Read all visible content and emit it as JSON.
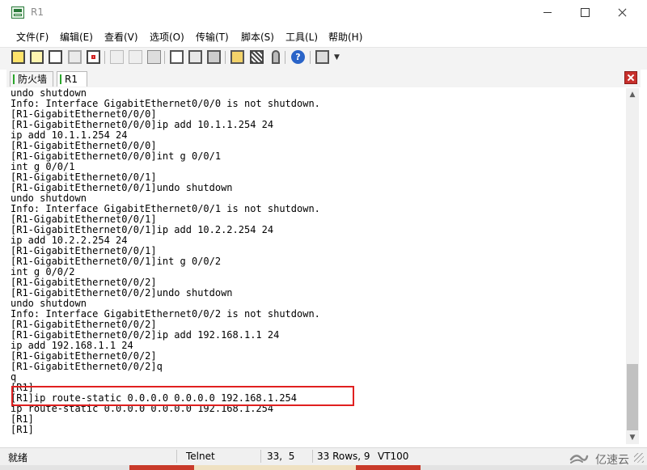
{
  "window": {
    "title": "R1"
  },
  "menu": [
    "文件(F)",
    "编辑(E)",
    "查看(V)",
    "选项(O)",
    "传输(T)",
    "脚本(S)",
    "工具(L)",
    "帮助(H)"
  ],
  "tabs": [
    {
      "label": "防火墙",
      "status_color": "#2aa52a"
    },
    {
      "label": "R1",
      "status_color": "#2aa52a"
    }
  ],
  "terminal": {
    "lines": [
      "undo shutdown",
      "Info: Interface GigabitEthernet0/0/0 is not shutdown.",
      "[R1-GigabitEthernet0/0/0]",
      "[R1-GigabitEthernet0/0/0]ip add 10.1.1.254 24",
      "ip add 10.1.1.254 24",
      "[R1-GigabitEthernet0/0/0]",
      "[R1-GigabitEthernet0/0/0]int g 0/0/1",
      "int g 0/0/1",
      "[R1-GigabitEthernet0/0/1]",
      "[R1-GigabitEthernet0/0/1]undo shutdown",
      "undo shutdown",
      "Info: Interface GigabitEthernet0/0/1 is not shutdown.",
      "[R1-GigabitEthernet0/0/1]",
      "[R1-GigabitEthernet0/0/1]ip add 10.2.2.254 24",
      "ip add 10.2.2.254 24",
      "[R1-GigabitEthernet0/0/1]",
      "[R1-GigabitEthernet0/0/1]int g 0/0/2",
      "int g 0/0/2",
      "[R1-GigabitEthernet0/0/2]",
      "[R1-GigabitEthernet0/0/2]undo shutdown",
      "undo shutdown",
      "Info: Interface GigabitEthernet0/0/2 is not shutdown.",
      "[R1-GigabitEthernet0/0/2]",
      "[R1-GigabitEthernet0/0/2]ip add 192.168.1.1 24",
      "ip add 192.168.1.1 24",
      "[R1-GigabitEthernet0/0/2]",
      "[R1-GigabitEthernet0/0/2]q",
      "q",
      "[R1]",
      "[R1]ip route-static 0.0.0.0 0.0.0.0 192.168.1.254",
      "ip route-static 0.0.0.0 0.0.0.0 192.168.1.254",
      "[R1]",
      "[R1]"
    ],
    "highlight_color": "#e02020"
  },
  "status": {
    "ready": "就绪",
    "protocol": "Telnet",
    "cursor": "33,  5",
    "rows": "33 Rows, 9",
    "emulation": "VT100"
  },
  "watermark": {
    "text": "亿速云"
  }
}
